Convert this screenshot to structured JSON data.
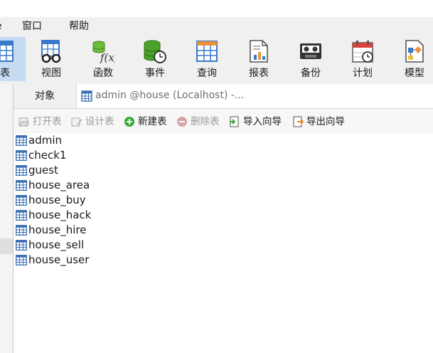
{
  "menu": {
    "partial_left": "e",
    "window": "窗口",
    "help": "帮助"
  },
  "toolbar": {
    "items": [
      {
        "label": "表",
        "icon": "table-icon"
      },
      {
        "label": "视图",
        "icon": "view-icon"
      },
      {
        "label": "函数",
        "icon": "function-icon"
      },
      {
        "label": "事件",
        "icon": "event-icon"
      },
      {
        "label": "查询",
        "icon": "query-icon"
      },
      {
        "label": "报表",
        "icon": "report-icon"
      },
      {
        "label": "备份",
        "icon": "backup-icon"
      },
      {
        "label": "计划",
        "icon": "schedule-icon"
      },
      {
        "label": "模型",
        "icon": "model-icon"
      }
    ],
    "active_index": 0
  },
  "tabs": {
    "objects": "对象",
    "query_tab": "admin @house (Localhost) -..."
  },
  "object_toolbar": {
    "open_table": "打开表",
    "design_table": "设计表",
    "new_table": "新建表",
    "delete_table": "删除表",
    "import_wizard": "导入向导",
    "export_wizard": "导出向导"
  },
  "tables": [
    "admin",
    "check1",
    "guest",
    "house_area",
    "house_buy",
    "house_hack",
    "house_hire",
    "house_sell",
    "house_user"
  ],
  "colors": {
    "toolbar_bg": "#f0f0f0",
    "active_bg": "#c5dcf3",
    "tab_text": "#6f6f6f",
    "disabled_text": "#9a9a9a"
  }
}
